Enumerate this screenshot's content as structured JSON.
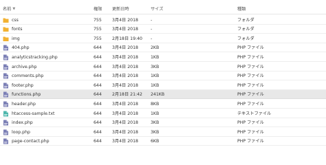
{
  "columns": {
    "name": "名前",
    "permissions": "権限",
    "modified": "更新日時",
    "size": "サイズ",
    "type": "種類"
  },
  "rows": [
    {
      "icon": "folder-icon",
      "name": "css",
      "perm": "755",
      "modified": "3月4日 2018",
      "size": "-",
      "type": "フォルダ"
    },
    {
      "icon": "folder-icon",
      "name": "fonts",
      "perm": "755",
      "modified": "3月4日 2018",
      "size": "-",
      "type": "フォルダ"
    },
    {
      "icon": "folder-icon",
      "name": "img",
      "perm": "755",
      "modified": "2月18日 19:40",
      "size": "-",
      "type": "フォルダ"
    },
    {
      "icon": "php-file-icon",
      "name": "404.php",
      "perm": "644",
      "modified": "3月4日 2018",
      "size": "2KB",
      "type": "PHP ファイル"
    },
    {
      "icon": "php-file-icon",
      "name": "analyticstracking.php",
      "perm": "644",
      "modified": "3月4日 2018",
      "size": "1KB",
      "type": "PHP ファイル"
    },
    {
      "icon": "php-file-icon",
      "name": "archive.php",
      "perm": "644",
      "modified": "3月4日 2018",
      "size": "3KB",
      "type": "PHP ファイル"
    },
    {
      "icon": "php-file-icon",
      "name": "comments.php",
      "perm": "644",
      "modified": "3月4日 2018",
      "size": "1KB",
      "type": "PHP ファイル"
    },
    {
      "icon": "php-file-icon",
      "name": "footer.php",
      "perm": "644",
      "modified": "3月4日 2018",
      "size": "1KB",
      "type": "PHP ファイル"
    },
    {
      "icon": "php-file-icon",
      "name": "functions.php",
      "perm": "644",
      "modified": "2月18日 21:42",
      "size": "241KB",
      "type": "PHP ファイル",
      "selected": true
    },
    {
      "icon": "php-file-icon",
      "name": "header.php",
      "perm": "644",
      "modified": "3月4日 2018",
      "size": "8KB",
      "type": "PHP ファイル"
    },
    {
      "icon": "text-file-icon",
      "name": "htaccess-sample.txt",
      "perm": "644",
      "modified": "3月4日 2018",
      "size": "1KB",
      "type": "テキストファイル"
    },
    {
      "icon": "php-file-icon",
      "name": "index.php",
      "perm": "644",
      "modified": "3月4日 2018",
      "size": "3KB",
      "type": "PHP ファイル"
    },
    {
      "icon": "php-file-icon",
      "name": "loop.php",
      "perm": "644",
      "modified": "3月4日 2018",
      "size": "3KB",
      "type": "PHP ファイル"
    },
    {
      "icon": "php-file-icon",
      "name": "page-contact.php",
      "perm": "644",
      "modified": "3月4日 2018",
      "size": "6KB",
      "type": "PHP ファイル"
    }
  ],
  "colors": {
    "folder": "#f2b233",
    "php": "#7b7fb5",
    "text": "#4db6ac",
    "selected": "#e8e8e8"
  }
}
